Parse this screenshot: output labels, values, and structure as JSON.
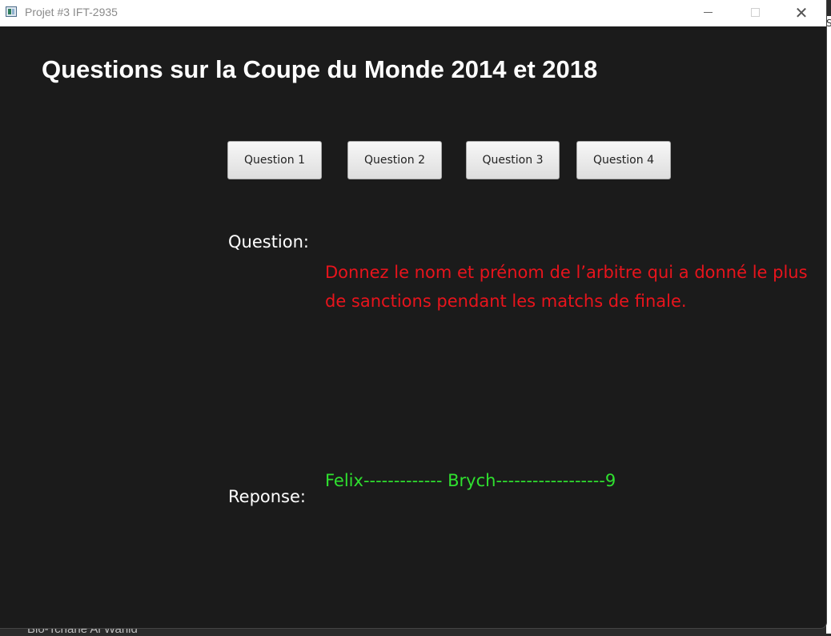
{
  "window": {
    "title": "Projet #3 IFT-2935",
    "close_glyph": "✕",
    "icons": {
      "app": "java-app-icon",
      "minimize": "minimize-icon",
      "maximize": "maximize-icon",
      "close": "close-icon"
    }
  },
  "page": {
    "title": "Questions sur la Coupe du Monde 2014 et 2018"
  },
  "buttons": [
    {
      "label": "Question 1"
    },
    {
      "label": "Question 2"
    },
    {
      "label": "Question 3"
    },
    {
      "label": "Question 4"
    }
  ],
  "question": {
    "label": "Question:",
    "text": "Donnez le nom et prénom de l’arbitre qui a donné le plus\n de sanctions pendant les matchs de finale."
  },
  "response": {
    "label": "Reponse:",
    "text": "Felix------------- Brych------------------9"
  },
  "colors": {
    "background": "#1b1b1b",
    "question_text": "#e8141c",
    "answer_text": "#2fe02f",
    "label_text": "#ffffff"
  },
  "background_app": {
    "partial_text": "Bio-Tchane Al Wahid",
    "edge_glyph": "Sc"
  }
}
